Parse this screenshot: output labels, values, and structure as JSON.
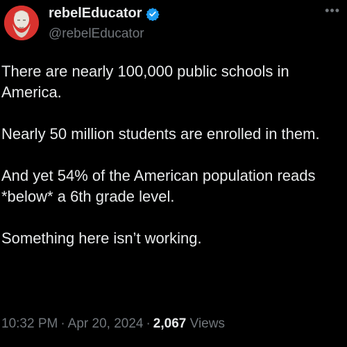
{
  "author": {
    "display_name": "rebelEducator",
    "handle": "@rebelEducator",
    "verified_icon": "verified-badge-icon",
    "avatar_color": "#d8322e"
  },
  "more_icon": "more-options-icon",
  "tweet": {
    "paragraphs": [
      "There are nearly 100,000 public schools in America.",
      "Nearly 50 million students are enrolled in them.",
      "And yet 54% of the American population reads *below* a 6th grade level.",
      "Something here isn’t working."
    ]
  },
  "meta": {
    "time": "10:32 PM",
    "separator": "·",
    "date": "Apr 20, 2024",
    "views_count": "2,067",
    "views_label": "Views"
  },
  "colors": {
    "background": "#000000",
    "text": "#e7e9ea",
    "secondary": "#71767b",
    "verified": "#1d9bf0"
  }
}
